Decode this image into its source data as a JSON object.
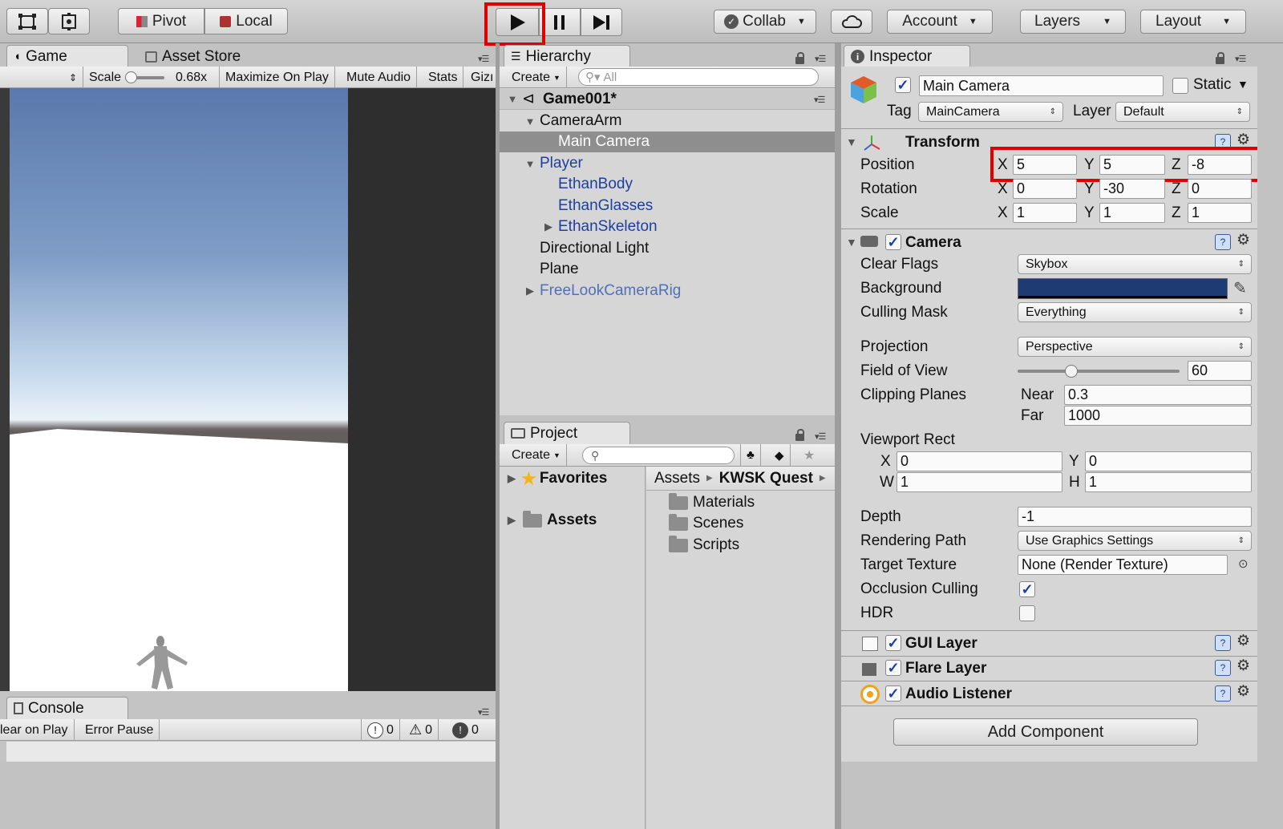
{
  "toolbar": {
    "pivot_label": "Pivot",
    "local_label": "Local",
    "collab_label": "Collab",
    "account_label": "Account",
    "layers_label": "Layers",
    "layout_label": "Layout"
  },
  "game": {
    "tab_label": "Game",
    "asset_store_label": "Asset Store",
    "scale_label": "Scale",
    "scale_value": "0.68x",
    "maximize_label": "Maximize On Play",
    "mute_label": "Mute Audio",
    "stats_label": "Stats",
    "gizmos_label": "Gizı"
  },
  "console": {
    "tab_label": "Console",
    "clear_label": "lear on Play",
    "error_pause_label": "Error Pause",
    "info_count": "0",
    "warn_count": "0",
    "error_count": "0"
  },
  "hierarchy": {
    "tab_label": "Hierarchy",
    "create_label": "Create",
    "search_placeholder": "All",
    "scene_name": "Game001*",
    "items": [
      {
        "label": "CameraArm"
      },
      {
        "label": "Main Camera"
      },
      {
        "label": "Player"
      },
      {
        "label": "EthanBody"
      },
      {
        "label": "EthanGlasses"
      },
      {
        "label": "EthanSkeleton"
      },
      {
        "label": "Directional Light"
      },
      {
        "label": "Plane"
      },
      {
        "label": "FreeLookCameraRig"
      }
    ]
  },
  "project": {
    "tab_label": "Project",
    "create_label": "Create",
    "favorites_label": "Favorites",
    "assets_label": "Assets",
    "breadcrumb_root": "Assets",
    "breadcrumb_current": "KWSK Quest",
    "folders": [
      "Materials",
      "Scenes",
      "Scripts"
    ]
  },
  "inspector": {
    "tab_label": "Inspector",
    "object_name": "Main Camera",
    "static_label": "Static",
    "tag_label": "Tag",
    "tag_value": "MainCamera",
    "layer_label": "Layer",
    "layer_value": "Default",
    "transform": {
      "title": "Transform",
      "position_label": "Position",
      "rotation_label": "Rotation",
      "scale_label": "Scale",
      "axis_x": "X",
      "axis_y": "Y",
      "axis_z": "Z",
      "position": [
        "5",
        "5",
        "-8"
      ],
      "rotation": [
        "0",
        "-30",
        "0"
      ],
      "scale": [
        "1",
        "1",
        "1"
      ]
    },
    "camera": {
      "title": "Camera",
      "clear_flags_label": "Clear Flags",
      "clear_flags_value": "Skybox",
      "background_label": "Background",
      "background_color": "#1f3b73",
      "culling_mask_label": "Culling Mask",
      "culling_mask_value": "Everything",
      "projection_label": "Projection",
      "projection_value": "Perspective",
      "fov_label": "Field of View",
      "fov_value": "60",
      "fov_slider_fraction": 0.33,
      "clipping_label": "Clipping Planes",
      "near_label": "Near",
      "near_value": "0.3",
      "far_label": "Far",
      "far_value": "1000",
      "viewport_label": "Viewport Rect",
      "vp_x_label": "X",
      "vp_x": "0",
      "vp_y_label": "Y",
      "vp_y": "0",
      "vp_w_label": "W",
      "vp_w": "1",
      "vp_h_label": "H",
      "vp_h": "1",
      "depth_label": "Depth",
      "depth_value": "-1",
      "rendering_path_label": "Rendering Path",
      "rendering_path_value": "Use Graphics Settings",
      "target_texture_label": "Target Texture",
      "target_texture_value": "None (Render Texture)",
      "occlusion_label": "Occlusion Culling",
      "hdr_label": "HDR"
    },
    "gui_layer_label": "GUI Layer",
    "flare_layer_label": "Flare Layer",
    "audio_listener_label": "Audio Listener",
    "add_component_label": "Add Component"
  }
}
